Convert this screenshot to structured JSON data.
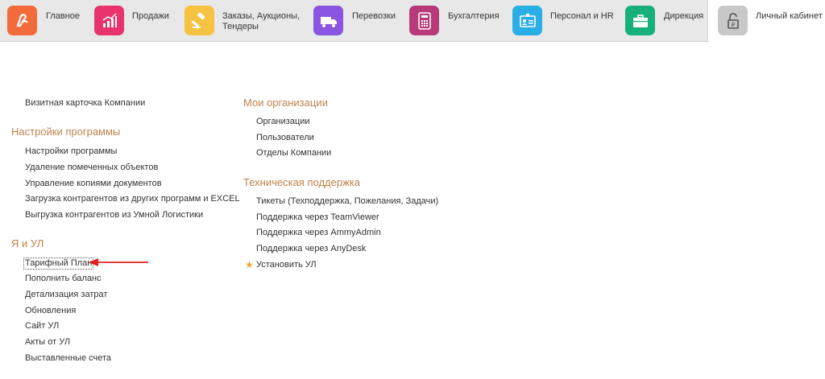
{
  "nav": {
    "sections": [
      {
        "label": "Главное",
        "icon": "logo-icon",
        "color": "#f26b3a"
      },
      {
        "label": "Продажи",
        "icon": "chart-icon",
        "color": "#e8336d"
      },
      {
        "label": "Заказы,  Аукционы,\nТендеры",
        "icon": "gavel-icon",
        "color": "#f5c242"
      },
      {
        "label": "Перевозки",
        "icon": "truck-icon",
        "color": "#8a55e0"
      },
      {
        "label": "Бухгалтерия",
        "icon": "calculator-icon",
        "color": "#b83a78"
      },
      {
        "label": "Персонал и HR",
        "icon": "badge-icon",
        "color": "#29aee6"
      },
      {
        "label": "Дирекция",
        "icon": "briefcase-icon",
        "color": "#18b07a"
      },
      {
        "label": "Личный кабинет",
        "icon": "lock-icon",
        "color": "#c8c8c8"
      }
    ]
  },
  "left": {
    "top_link": "Визитная карточка Компании",
    "settings": {
      "title": "Настройки программы",
      "items": [
        "Настройки программы",
        "Удаление помеченных объектов",
        "Управление копиями документов",
        "Загрузка контрагентов из других программ и EXCEL",
        "Выгрузка контрагентов из Умной Логистики"
      ]
    },
    "ul": {
      "title": "Я и УЛ",
      "items": [
        "Тарифный План",
        "Пополнить баланс",
        "Детализация затрат",
        "Обновления",
        "Сайт УЛ",
        "Акты от УЛ",
        "Выставленные счета"
      ]
    }
  },
  "right": {
    "orgs": {
      "title": "Мои организации",
      "items": [
        "Организации",
        "Пользователи",
        "Отделы Компании"
      ]
    },
    "support": {
      "title": "Техническая поддержка",
      "items": [
        "Тикеты (Техподдержка, Пожелания, Задачи)",
        "Поддержка через TeamViewer",
        "Поддержка через AmmyAdmin",
        "Поддержка через AnyDesk",
        "Установить УЛ"
      ]
    }
  },
  "colors": {
    "accent_title": "#c0824a",
    "arrow": "#e02020",
    "star": "#f0a830"
  }
}
